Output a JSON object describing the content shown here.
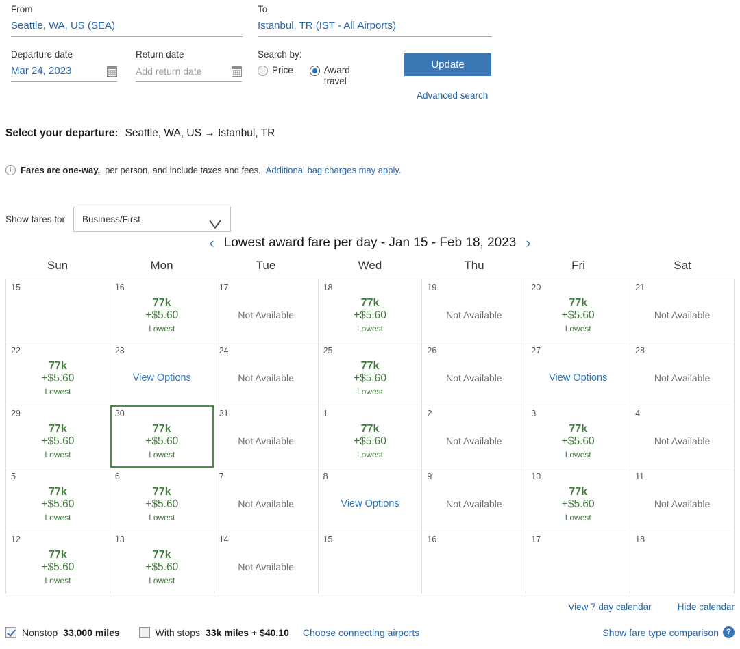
{
  "search": {
    "from_label": "From",
    "from_value": "Seattle, WA, US (SEA)",
    "to_label": "To",
    "to_value": "Istanbul, TR (IST - All Airports)",
    "departure_label": "Departure date",
    "departure_value": "Mar 24, 2023",
    "return_label": "Return date",
    "return_placeholder": "Add return date",
    "search_by_label": "Search by:",
    "option_price": "Price",
    "option_award": "Award travel",
    "selected_option": "Award travel",
    "update_label": "Update",
    "advanced_search_label": "Advanced search"
  },
  "departure_header": {
    "title": "Select your departure:",
    "route": "Seattle, WA, US → Istanbul, TR"
  },
  "fares_note": {
    "bold": "Fares are one-way,",
    "normal": " per person, and include taxes and fees.",
    "link": "Additional bag charges may apply."
  },
  "show_fares": {
    "label": "Show fares for",
    "selected": "Business/First"
  },
  "calendar": {
    "prev_icon": "‹",
    "next_icon": "›",
    "title": "Lowest award fare per day - Jan 15 - Feb 18, 2023",
    "weekdays": [
      "Sun",
      "Mon",
      "Tue",
      "Wed",
      "Thu",
      "Fri",
      "Sat"
    ],
    "labels": {
      "not_available": "Not Available",
      "view_options": "View Options",
      "lowest": "Lowest"
    },
    "cells": [
      {
        "day": "15",
        "type": "empty"
      },
      {
        "day": "16",
        "type": "fare",
        "miles": "77k",
        "tax": "+$5.60",
        "note": "Lowest"
      },
      {
        "day": "17",
        "type": "na",
        "text": "Not Available"
      },
      {
        "day": "18",
        "type": "fare",
        "miles": "77k",
        "tax": "+$5.60",
        "note": "Lowest"
      },
      {
        "day": "19",
        "type": "na",
        "text": "Not Available"
      },
      {
        "day": "20",
        "type": "fare",
        "miles": "77k",
        "tax": "+$5.60",
        "note": "Lowest"
      },
      {
        "day": "21",
        "type": "na",
        "text": "Not Available"
      },
      {
        "day": "22",
        "type": "fare",
        "miles": "77k",
        "tax": "+$5.60",
        "note": "Lowest"
      },
      {
        "day": "23",
        "type": "opts",
        "text": "View Options"
      },
      {
        "day": "24",
        "type": "na",
        "text": "Not Available"
      },
      {
        "day": "25",
        "type": "fare",
        "miles": "77k",
        "tax": "+$5.60",
        "note": "Lowest"
      },
      {
        "day": "26",
        "type": "na",
        "text": "Not Available"
      },
      {
        "day": "27",
        "type": "opts",
        "text": "View Options"
      },
      {
        "day": "28",
        "type": "na",
        "text": "Not Available"
      },
      {
        "day": "29",
        "type": "fare",
        "miles": "77k",
        "tax": "+$5.60",
        "note": "Lowest"
      },
      {
        "day": "30",
        "type": "fare",
        "miles": "77k",
        "tax": "+$5.60",
        "note": "Lowest",
        "selected": true
      },
      {
        "day": "31",
        "type": "na",
        "text": "Not Available"
      },
      {
        "day": "1",
        "type": "fare",
        "miles": "77k",
        "tax": "+$5.60",
        "note": "Lowest"
      },
      {
        "day": "2",
        "type": "na",
        "text": "Not Available"
      },
      {
        "day": "3",
        "type": "fare",
        "miles": "77k",
        "tax": "+$5.60",
        "note": "Lowest"
      },
      {
        "day": "4",
        "type": "na",
        "text": "Not Available"
      },
      {
        "day": "5",
        "type": "fare",
        "miles": "77k",
        "tax": "+$5.60",
        "note": "Lowest"
      },
      {
        "day": "6",
        "type": "fare",
        "miles": "77k",
        "tax": "+$5.60",
        "note": "Lowest"
      },
      {
        "day": "7",
        "type": "na",
        "text": "Not Available"
      },
      {
        "day": "8",
        "type": "opts",
        "text": "View Options"
      },
      {
        "day": "9",
        "type": "na",
        "text": "Not Available"
      },
      {
        "day": "10",
        "type": "fare",
        "miles": "77k",
        "tax": "+$5.60",
        "note": "Lowest"
      },
      {
        "day": "11",
        "type": "na",
        "text": "Not Available"
      },
      {
        "day": "12",
        "type": "fare",
        "miles": "77k",
        "tax": "+$5.60",
        "note": "Lowest"
      },
      {
        "day": "13",
        "type": "fare",
        "miles": "77k",
        "tax": "+$5.60",
        "note": "Lowest"
      },
      {
        "day": "14",
        "type": "na",
        "text": "Not Available"
      },
      {
        "day": "15",
        "type": "empty"
      },
      {
        "day": "16",
        "type": "empty"
      },
      {
        "day": "17",
        "type": "empty"
      },
      {
        "day": "18",
        "type": "empty"
      }
    ],
    "view_7_day": "View 7 day calendar",
    "hide_calendar": "Hide calendar"
  },
  "bottom": {
    "nonstop_label": "Nonstop",
    "nonstop_value": "33,000 miles",
    "nonstop_checked": true,
    "with_stops_label": "With stops",
    "with_stops_value": "33k miles + $40.10",
    "with_stops_checked": false,
    "choose_airports": "Choose connecting airports",
    "fare_comparison": "Show fare type comparison",
    "help_glyph": "?"
  },
  "colors": {
    "accent_blue": "#3b77b4",
    "link_blue": "#2566a8",
    "fare_green": "#44793f",
    "selected_green": "#4f8a4f",
    "muted_gray": "#6d6d6d"
  }
}
